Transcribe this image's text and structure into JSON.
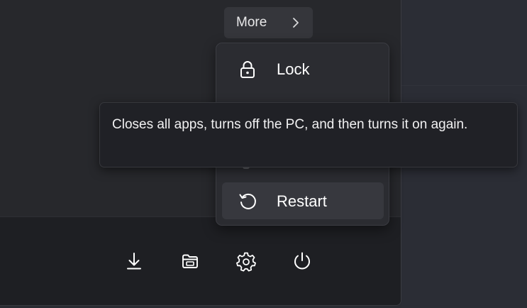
{
  "more": {
    "label": "More",
    "chevron_icon": "chevron-right-icon"
  },
  "flyout": {
    "items": [
      {
        "label": "Lock",
        "icon": "lock-icon"
      },
      {
        "label": "Restart",
        "icon": "restart-icon"
      }
    ]
  },
  "tooltip": {
    "text": "Closes all apps, turns off the PC, and then turns it on again."
  },
  "footer": {
    "icons": [
      "downloads-icon",
      "file-explorer-icon",
      "settings-icon",
      "power-icon"
    ]
  },
  "colors": {
    "panel": "#26272b",
    "flyout": "#2b2c31",
    "highlight": "#37383e",
    "tooltip": "#202126",
    "text": "#ffffff"
  }
}
